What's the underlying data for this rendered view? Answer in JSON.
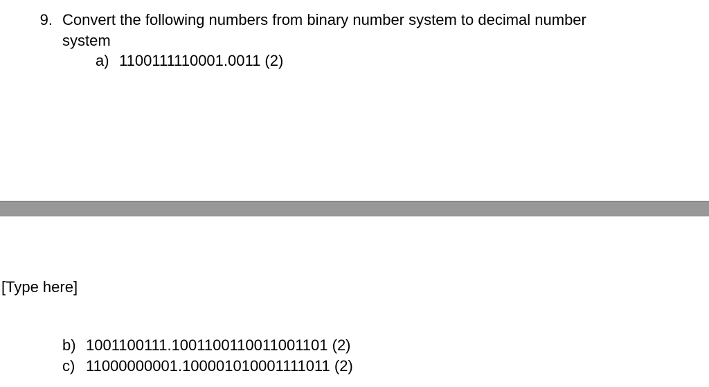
{
  "question": {
    "number": "9.",
    "prompt_line1": "Convert the following numbers from binary number system to decimal number",
    "prompt_line2": "system",
    "items": {
      "a": {
        "label": "a)",
        "value": "1100111110001.0011 (2)"
      },
      "b": {
        "label": "b)",
        "value": "1001100111.1001100110011001101 (2)"
      },
      "c": {
        "label": "c)",
        "value": "11000000001.100001010001111011 (2)"
      }
    }
  },
  "placeholder": "[Type here]"
}
